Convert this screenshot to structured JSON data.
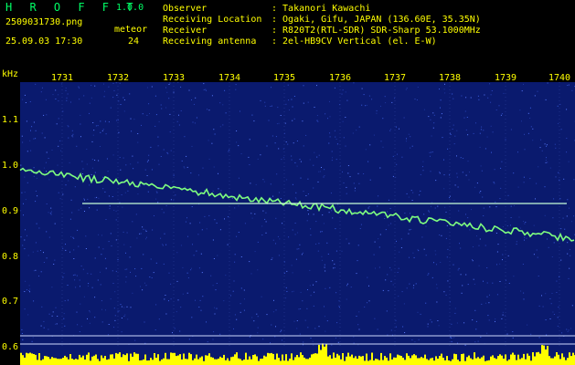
{
  "app": {
    "name": "H R O F F T",
    "version": "1.0.0"
  },
  "file": {
    "name": "2509031730.png",
    "datetime": "25.09.03 17:30"
  },
  "meteor": {
    "label": "meteor",
    "count": "24"
  },
  "info": [
    {
      "key": "Observer",
      "value": ": Takanori Kawachi"
    },
    {
      "key": "Receiving Location",
      "value": ": Ogaki, Gifu, JAPAN (136.60E, 35.35N)"
    },
    {
      "key": "Receiver",
      "value": ": R820T2(RTL-SDR) SDR-Sharp 53.1000MHz"
    },
    {
      "key": "Receiving antenna",
      "value": ": 2el-HB9CV Vertical (el. E-W)"
    }
  ],
  "spectrogram": {
    "unit_label": "kHz",
    "time_ticks": [
      "1731",
      "1732",
      "1733",
      "1734",
      "1735",
      "1736",
      "1737",
      "1738",
      "1739",
      "1740"
    ],
    "freq_ticks": [
      "1.1",
      "1.0",
      "0.9",
      "0.8",
      "0.7",
      "0.6"
    ],
    "colors": {
      "background": "#0a1a6e",
      "grid": "#2a3f9a",
      "trace": "#7fff7f",
      "activity": "#ffff00",
      "labels": "#ffff00"
    }
  }
}
